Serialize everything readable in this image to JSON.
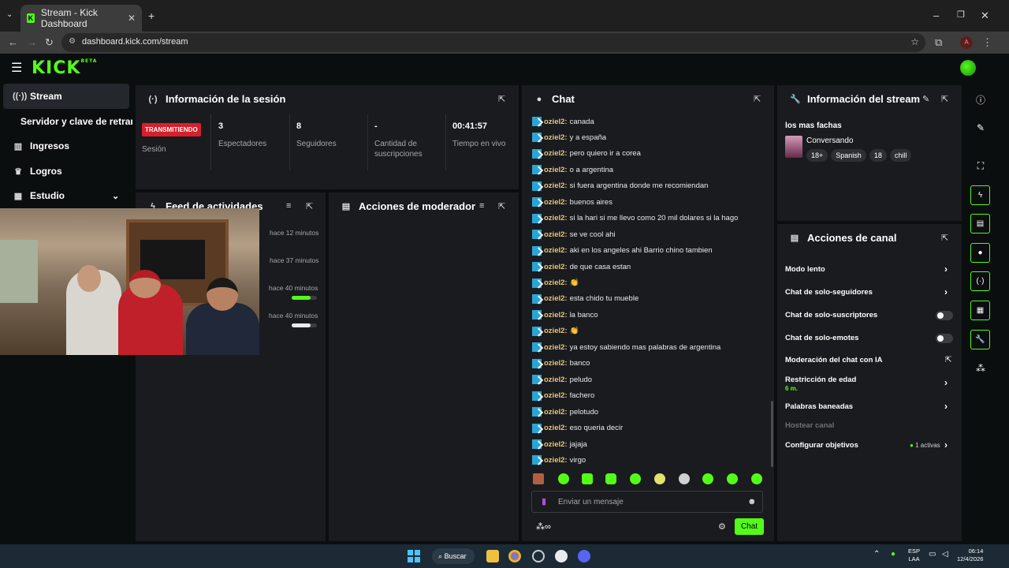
{
  "browser": {
    "tab_title": "Stream - Kick Dashboard",
    "url": "dashboard.kick.com/stream",
    "profile_initial": "A"
  },
  "brand": {
    "logo": "KICK",
    "logo_badge": "BETA",
    "accent": "#53fc18"
  },
  "sidebar": {
    "items": [
      {
        "label": "Stream",
        "icon": "broadcast-icon",
        "active": true
      },
      {
        "label": "Servidor y clave de retransmisión",
        "icon": "",
        "active": false
      },
      {
        "label": "Ingresos",
        "icon": "chart-icon",
        "active": false
      },
      {
        "label": "Logros",
        "icon": "trophy-icon",
        "active": false
      },
      {
        "label": "Estudio",
        "icon": "grid-icon",
        "active": false
      }
    ]
  },
  "session": {
    "title": "Información de la sesión",
    "live_badge": "TRANSMITIENDO",
    "live_label": "Sesión",
    "stats": [
      {
        "value": "3",
        "label": "Espectadores"
      },
      {
        "value": "8",
        "label": "Seguidores"
      },
      {
        "value": "-",
        "label": "Cantidad de suscripciones"
      },
      {
        "value": "00:41:57",
        "label": "Tiempo en vivo"
      }
    ]
  },
  "feed": {
    "title": "Feed de actividades",
    "entries": [
      {
        "time": "hace 12 minutos",
        "progress": null
      },
      {
        "time": "hace 37 minutos",
        "progress": null
      },
      {
        "time": "hace 40 minutos",
        "progress": 0.75
      },
      {
        "time": "hace 40 minutos",
        "progress": 0.75
      }
    ]
  },
  "mod_actions": {
    "title": "Acciones de moderador"
  },
  "chat": {
    "title": "Chat",
    "messages": [
      {
        "user": "oziel2:",
        "text": "canada"
      },
      {
        "user": "oziel2:",
        "text": "y a españa"
      },
      {
        "user": "oziel2:",
        "text": "pero quiero ir a corea"
      },
      {
        "user": "oziel2:",
        "text": "o a argentina"
      },
      {
        "user": "oziel2:",
        "text": "si fuera argentina donde me recomiendan"
      },
      {
        "user": "oziel2:",
        "text": "buenos aires"
      },
      {
        "user": "oziel2:",
        "text": "si la hari si me llevo como 20 mil dolares si la hago"
      },
      {
        "user": "oziel2:",
        "text": "se ve cool ahi"
      },
      {
        "user": "oziel2:",
        "text": "aki en los angeles ahi Barrio chino tambien"
      },
      {
        "user": "oziel2:",
        "text": "de que casa estan"
      },
      {
        "user": "oziel2:",
        "text": "👏"
      },
      {
        "user": "oziel2:",
        "text": "esta chido tu mueble"
      },
      {
        "user": "oziel2:",
        "text": "la banco"
      },
      {
        "user": "oziel2:",
        "text": "👏"
      },
      {
        "user": "oziel2:",
        "text": "ya estoy sabiendo mas palabras de argentina"
      },
      {
        "user": "oziel2:",
        "text": "banco"
      },
      {
        "user": "oziel2:",
        "text": "peludo"
      },
      {
        "user": "oziel2:",
        "text": "fachero"
      },
      {
        "user": "oziel2:",
        "text": "pelotudo"
      },
      {
        "user": "oziel2:",
        "text": "eso queria decir"
      },
      {
        "user": "oziel2:",
        "text": "jajaja"
      },
      {
        "user": "oziel2:",
        "text": "virgo"
      }
    ],
    "input_placeholder": "Enviar un mensaje",
    "send_label": "Chat"
  },
  "stream_info": {
    "title": "Información del stream",
    "stream_title": "los mas fachas",
    "category": "Conversando",
    "tags": [
      "18+",
      "Spanish",
      "18",
      "chill"
    ]
  },
  "channel_actions": {
    "title": "Acciones de canal",
    "items": [
      {
        "label": "Modo lento",
        "control": "chevron"
      },
      {
        "label": "Chat de solo-seguidores",
        "control": "chevron"
      },
      {
        "label": "Chat de solo-suscriptores",
        "control": "toggle"
      },
      {
        "label": "Chat de solo-emotes",
        "control": "toggle"
      },
      {
        "label": "Moderación del chat con IA",
        "control": "external"
      },
      {
        "label": "Restricción de edad",
        "sub": "6 m.",
        "control": "chevron"
      },
      {
        "label": "Palabras baneadas",
        "control": "chevron"
      },
      {
        "label": "Hostear canal",
        "control": "none"
      },
      {
        "label": "Configurar objetivos",
        "badge": "1 activas",
        "control": "chevron"
      }
    ]
  },
  "taskbar": {
    "search_label": "Buscar",
    "lang_top": "ESP",
    "lang_bottom": "LAA",
    "time": "06:14",
    "date": "12/4/2026"
  }
}
